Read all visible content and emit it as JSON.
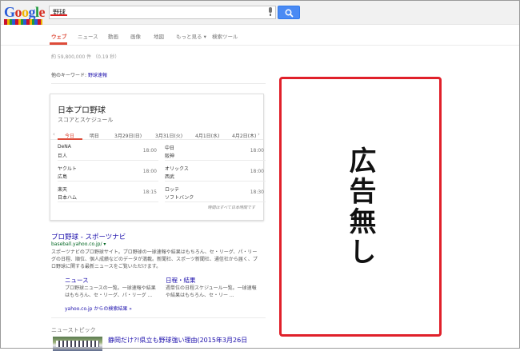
{
  "header": {
    "logo_text": "Google",
    "query": "野球",
    "mic_icon": "microphone-icon",
    "search_icon": "magnifier-icon",
    "accent_color": "#4a8af4"
  },
  "tabs": [
    {
      "label": "ウェブ",
      "active": true
    },
    {
      "label": "ニュース"
    },
    {
      "label": "動画"
    },
    {
      "label": "画像"
    },
    {
      "label": "地図"
    },
    {
      "label": "もっと見る ▾"
    },
    {
      "label": "検索ツール"
    }
  ],
  "stats": "約 59,800,000 件 （0.19 秒）",
  "related": {
    "label": "他のキーワード:",
    "link": "野球速報"
  },
  "card": {
    "title": "日本プロ野球",
    "subtitle": "スコアとスケジュール",
    "prev_icon": "chevron-left-icon",
    "next_icon": "chevron-right-icon",
    "dates": [
      "今日",
      "明日",
      "3月29日(日)",
      "3月31日(火)",
      "4月1日(水)",
      "4月2日(木)"
    ],
    "games": [
      {
        "team1": "DeNA",
        "team2": "巨人",
        "time": "18:00"
      },
      {
        "team1": "中日",
        "team2": "阪神",
        "time": "18:00"
      },
      {
        "team1": "ヤクルト",
        "team2": "広島",
        "time": "18:00"
      },
      {
        "team1": "オリックス",
        "team2": "西武",
        "time": "18:00"
      },
      {
        "team1": "楽天",
        "team2": "日本ハム",
        "time": "18:15"
      },
      {
        "team1": "ロッテ",
        "team2": "ソフトバンク",
        "time": "18:30"
      }
    ],
    "footer": "時間はすべて日本時間です"
  },
  "result": {
    "title": "プロ野球 - スポーツナビ",
    "url": "baseball.yahoo.co.jp/ ▾",
    "desc": "スポーツナビのプロ野球サイト。プロ野球の一球速報や結果はもちろん、セ・リーグ、パ・リーグの日程、順位、個人成績などのデータが満載。新聞社、スポーツ新聞社、通信社から届く、プロ野球に関する最新ニュースをご覧いただけます。",
    "sitelinks": [
      {
        "title": "ニュース",
        "desc": "プロ野球ニュースの一覧。一球速報や結果はもちろん、セ・リーグ、パ・リーグ ..."
      },
      {
        "title": "日程・結果",
        "desc": "週単位の日程スケジュール一覧。一球速報や結果はもちろん、セ・リー ..."
      }
    ],
    "more": "yahoo.co.jp からの検索結果 »"
  },
  "news": {
    "heading": "ニューストピック",
    "title": "静岡だけ?!県立も野球強い理由(2015年3月26日"
  },
  "ad": {
    "text": "広告無し",
    "border_color": "#e0202a"
  }
}
